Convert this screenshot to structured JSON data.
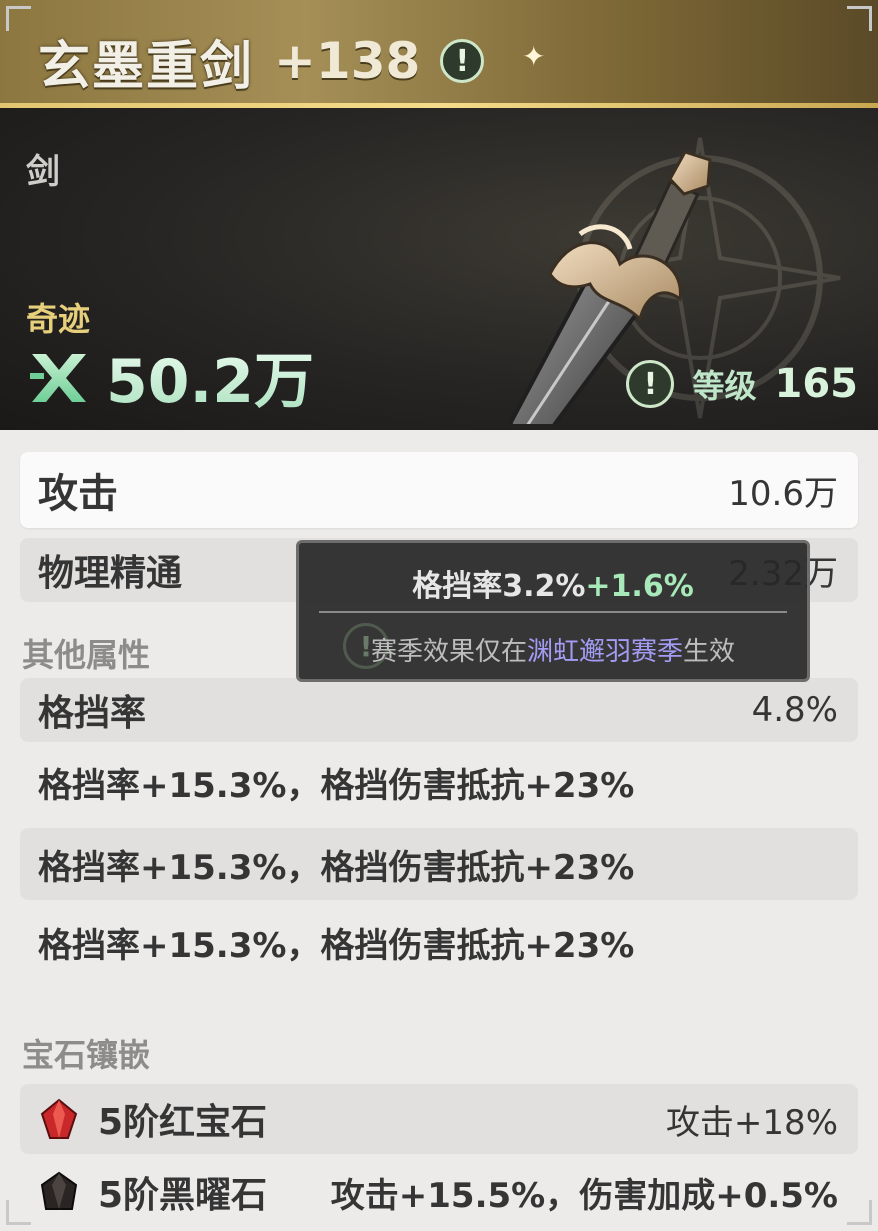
{
  "header": {
    "weapon_name": "玄墨重剑",
    "enhance_level": "+138",
    "alert_icon": "!"
  },
  "hero": {
    "weapon_type": "剑",
    "rarity": "奇迹",
    "power_value": "50.2万",
    "level_label": "等级",
    "level_value": "165",
    "level_alert_icon": "!"
  },
  "main_stats": [
    {
      "label": "攻击",
      "value": "10.6万"
    },
    {
      "label": "物理精通",
      "value": "2.32万"
    }
  ],
  "other_stats": {
    "title": "其他属性",
    "block_rate": {
      "label": "格挡率",
      "value": "4.8%"
    },
    "affixes": [
      "格挡率+15.3%，格挡伤害抵抗+23%",
      "格挡率+15.3%，格挡伤害抵抗+23%",
      "格挡率+15.3%，格挡伤害抵抗+23%"
    ]
  },
  "gems": {
    "title": "宝石镶嵌",
    "items": [
      {
        "name": "5阶红宝石",
        "effect": "攻击+18%",
        "icon": "ruby-icon",
        "color": "#c8282a"
      },
      {
        "name": "5阶黑曜石",
        "effect": "攻击+15.5%，伤害加成+0.5%",
        "icon": "obsidian-icon",
        "color": "#2a2522"
      }
    ]
  },
  "tooltip": {
    "base": "格挡率3.2%",
    "bonus": "+1.6%",
    "note_prefix": "赛季效果仅在",
    "season_name": "渊虹邂羽赛季",
    "note_suffix": "生效",
    "icon": "!"
  },
  "colors": {
    "header_gold": "#a58f57",
    "power_green": "#a9e0bd",
    "rarity_gold": "#e7cf7b",
    "season_purple": "#a39cf4",
    "bonus_green": "#a7e9b8"
  }
}
